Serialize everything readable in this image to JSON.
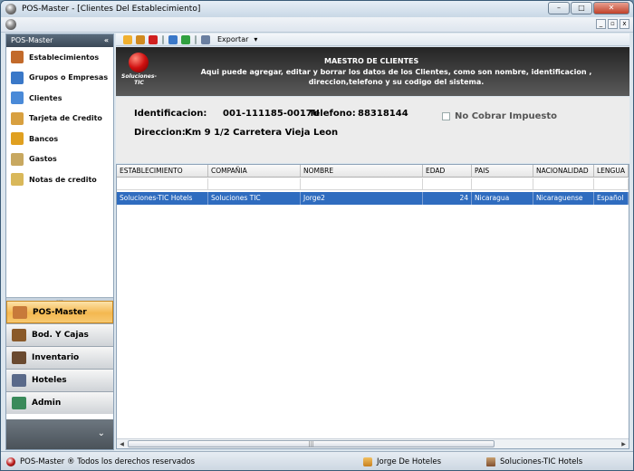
{
  "window": {
    "title": "POS-Master - [Clientes Del Establecimiento]"
  },
  "window_buttons": {
    "minimize": "–",
    "maximize": "□",
    "close": "✕"
  },
  "mdi_buttons": {
    "minimize": "_",
    "restore": "▫",
    "close": "x"
  },
  "sidebar": {
    "title": "POS-Master",
    "collapse": "«",
    "items": [
      {
        "label": "Establecimientos",
        "icon": "house-icon",
        "color": "#c26a2a"
      },
      {
        "label": "Grupos o Empresas",
        "icon": "people-icon",
        "color": "#3a78c8"
      },
      {
        "label": "Clientes",
        "icon": "person-icon",
        "color": "#4a8ad8"
      },
      {
        "label": "Tarjeta de Credito",
        "icon": "card-icon",
        "color": "#d8a040"
      },
      {
        "label": "Bancos",
        "icon": "coin-icon",
        "color": "#e0a020"
      },
      {
        "label": "Gastos",
        "icon": "money-bag-icon",
        "color": "#c8a860"
      },
      {
        "label": "Notas de credito",
        "icon": "note-icon",
        "color": "#d9b85a"
      }
    ],
    "splitter": "....",
    "groups": [
      {
        "label": "POS-Master",
        "icon": "house-icon",
        "active": true
      },
      {
        "label": "Bod. Y Cajas",
        "icon": "boxes-icon",
        "active": false
      },
      {
        "label": "Inventario",
        "icon": "inventory-icon",
        "active": false
      },
      {
        "label": "Hoteles",
        "icon": "building-icon",
        "active": false
      },
      {
        "label": "Admin",
        "icon": "chart-icon",
        "active": false
      }
    ],
    "expand": "⌄"
  },
  "toolbar": {
    "buttons": [
      {
        "icon": "new-icon",
        "color": "#f0b030"
      },
      {
        "icon": "edit-icon",
        "color": "#d08a20"
      },
      {
        "icon": "delete-icon",
        "color": "#d02020"
      },
      {
        "icon": "search-icon",
        "color": "#3a78c8"
      },
      {
        "icon": "refresh-icon",
        "color": "#30a040"
      }
    ],
    "export_label": "Exportar",
    "export_arrow": "▾"
  },
  "banner": {
    "logo_text": "Soluciones-TIC",
    "title": "MAESTRO DE CLIENTES",
    "description": "Aqui puede agregar, editar y borrar los datos de los Clientes, como son nombre, identificacion , direccion,telefono y su codigo del sistema."
  },
  "client": {
    "id_label": "Identificacion:",
    "id_value": "001-111185-0017U",
    "phone_label": "Telefono:",
    "phone_value": "88318144",
    "address_label": "Direccion:",
    "address_value": "Km 9 1/2 Carretera Vieja Leon",
    "tax_exempt_label": "No Cobrar Impuesto",
    "tax_exempt": false
  },
  "grid": {
    "columns": [
      "ESTABLECIMIENTO",
      "COMPAÑIA",
      "NOMBRE",
      "EDAD",
      "PAIS",
      "NACIONALIDAD",
      "LENGUA"
    ],
    "rows": [
      [
        "Soluciones-TIC Hotels",
        "Soluciones TIC",
        "Jorge2",
        "24",
        "Nicaragua",
        "Nicaraguense",
        "Español"
      ]
    ],
    "scroll_left": "◀",
    "scroll_right": "▶",
    "scroll_grip": "|||"
  },
  "status": {
    "app": "POS-Master ®  Todos los derechos reservados",
    "user": "Jorge   De Hoteles",
    "establishment": "Soluciones-TIC Hotels"
  }
}
